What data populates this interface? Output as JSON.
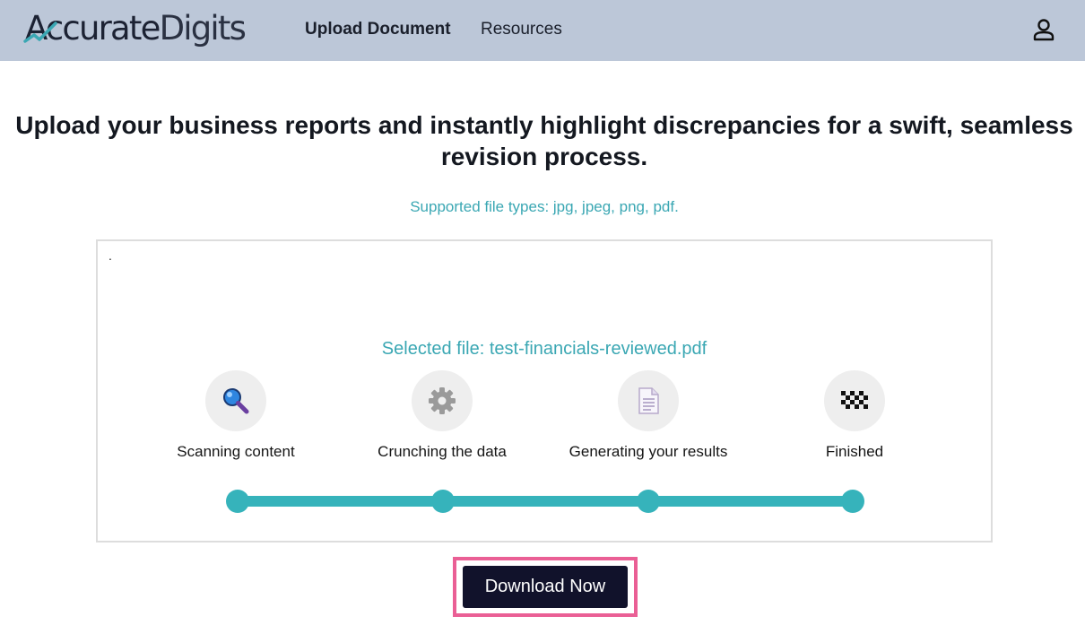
{
  "brand": {
    "name_part1": "Accurate",
    "name_part2": "Digits",
    "accent_color": "#3aa7b3"
  },
  "nav": {
    "items": [
      {
        "label": "Upload Document",
        "active": true
      },
      {
        "label": "Resources",
        "active": false
      }
    ],
    "user_icon": "user-icon"
  },
  "main": {
    "headline": "Upload your business reports and instantly highlight discrepancies for a swift, seamless revision process.",
    "supported_types": "Supported file types: jpg, jpeg, png, pdf.",
    "panel": {
      "marker": ".",
      "selected_file": "Selected file: test-financials-reviewed.pdf",
      "steps": [
        {
          "label": "Scanning content",
          "icon": "magnifier-icon"
        },
        {
          "label": "Crunching the data",
          "icon": "gear-icon"
        },
        {
          "label": "Generating your results",
          "icon": "document-icon"
        },
        {
          "label": "Finished",
          "icon": "checkered-flag-icon"
        }
      ],
      "progress": {
        "completed_steps": 4,
        "total_steps": 4,
        "color": "#36b3bb"
      }
    },
    "download_button": {
      "label": "Download Now",
      "highlight_color": "#ea5f95",
      "button_color": "#11122b"
    }
  }
}
